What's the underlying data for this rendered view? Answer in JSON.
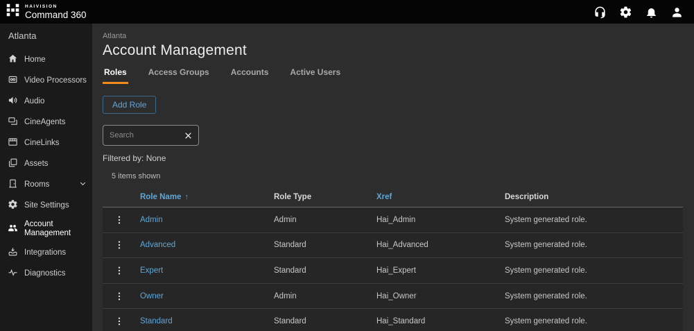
{
  "app": {
    "brand_top": "HAIVISION",
    "brand_name": "Command 360"
  },
  "topbar": {
    "icons": [
      "support-icon",
      "settings-icon",
      "notifications-icon",
      "user-icon"
    ]
  },
  "sidebar": {
    "site_name": "Atlanta",
    "items": [
      {
        "label": "Home"
      },
      {
        "label": "Video Processors"
      },
      {
        "label": "Audio"
      },
      {
        "label": "CineAgents"
      },
      {
        "label": "CineLinks"
      },
      {
        "label": "Assets"
      },
      {
        "label": "Rooms",
        "expandable": true
      },
      {
        "label": "Site Settings"
      },
      {
        "label": "Account Management",
        "active": true
      },
      {
        "label": "Integrations"
      },
      {
        "label": "Diagnostics"
      }
    ]
  },
  "main": {
    "breadcrumb": "Atlanta",
    "title": "Account Management",
    "tabs": [
      {
        "label": "Roles",
        "active": true
      },
      {
        "label": "Access Groups",
        "active": false
      },
      {
        "label": "Accounts",
        "active": false
      },
      {
        "label": "Active Users",
        "active": false
      }
    ],
    "add_button": "Add Role",
    "search_placeholder": "Search",
    "filtered_by": "Filtered by: None",
    "items_shown": "5 items shown",
    "table": {
      "columns": [
        "Role Name",
        "Role Type",
        "Xref",
        "Description"
      ],
      "sort_column": "Role Name",
      "sort_indicator": "↑",
      "rows": [
        {
          "role_name": "Admin",
          "role_type": "Admin",
          "xref": "Hai_Admin",
          "description": "System generated role."
        },
        {
          "role_name": "Advanced",
          "role_type": "Standard",
          "xref": "Hai_Advanced",
          "description": "System generated role."
        },
        {
          "role_name": "Expert",
          "role_type": "Standard",
          "xref": "Hai_Expert",
          "description": "System generated role."
        },
        {
          "role_name": "Owner",
          "role_type": "Admin",
          "xref": "Hai_Owner",
          "description": "System generated role."
        },
        {
          "role_name": "Standard",
          "role_type": "Standard",
          "xref": "Hai_Standard",
          "description": "System generated role."
        }
      ]
    }
  },
  "colors": {
    "topbar_bg": "#050505",
    "sidebar_bg": "#1a1a1a",
    "main_bg": "#2d2d2d",
    "row_bg": "#262626",
    "accent_orange": "#f08a1d",
    "link_blue": "#5ea7d8"
  }
}
